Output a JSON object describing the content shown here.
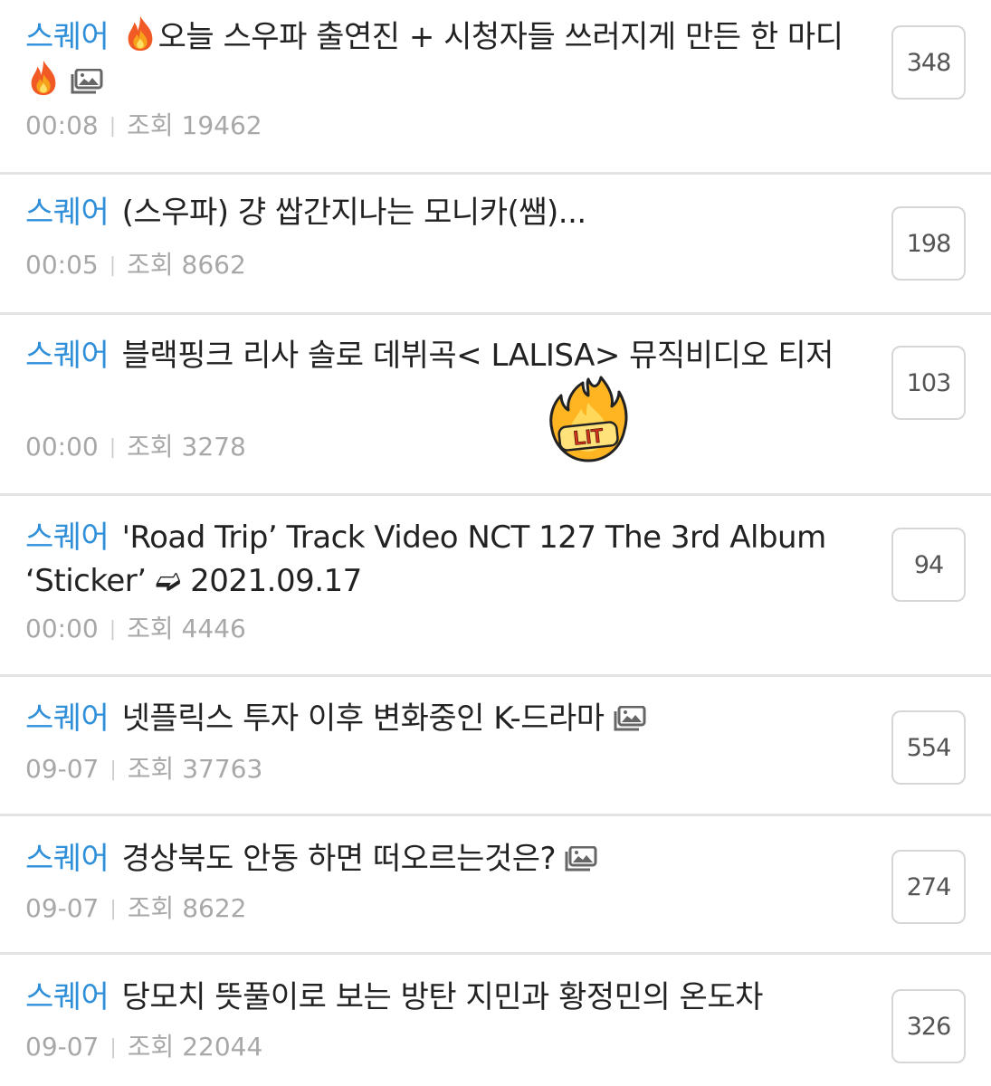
{
  "posts": [
    {
      "category": "스퀘어",
      "title_part1": "오늘 스우파 출연진 + 시청자들 쓰러지게 만든 한 마디",
      "date": "00:08",
      "views_label": "조회 19462",
      "comments": "348"
    },
    {
      "category": "스퀘어",
      "title": "(스우파) 걍 쌉간지나는 모니카(쌤)...",
      "date": "00:05",
      "views_label": "조회 8662",
      "comments": "198"
    },
    {
      "category": "스퀘어",
      "title": "블랙핑크 리사 솔로 데뷔곡< LALISA> 뮤직비디오 티저",
      "date": "00:00",
      "views_label": "조회 3278",
      "comments": "103",
      "sticker_text": "LIT"
    },
    {
      "category": "스퀘어",
      "title": "'Road Trip’ Track Video NCT 127 The 3rd Album ‘Sticker’ ➫ 2021.09.17",
      "date": "00:00",
      "views_label": "조회 4446",
      "comments": "94"
    },
    {
      "category": "스퀘어",
      "title": "넷플릭스 투자 이후 변화중인 K-드라마",
      "date": "09-07",
      "views_label": "조회 37763",
      "comments": "554"
    },
    {
      "category": "스퀘어",
      "title": "경상북도 안동 하면 떠오르는것은?",
      "date": "09-07",
      "views_label": "조회 8622",
      "comments": "274"
    },
    {
      "category": "스퀘어",
      "title": "당모치 뜻풀이로 보는 방탄 지민과 황정민의 온도차",
      "date": "09-07",
      "views_label": "조회 22044",
      "comments": "326"
    }
  ],
  "icons": {
    "fire": "fire-emoji-icon",
    "image": "image-attachment-icon",
    "sticker": "lit-fire-sticker"
  },
  "colors": {
    "category": "#2f8fd8",
    "title": "#222222",
    "meta": "#a8a8a8",
    "divider": "#e3e3e3",
    "count_border": "#d6d6d6"
  }
}
